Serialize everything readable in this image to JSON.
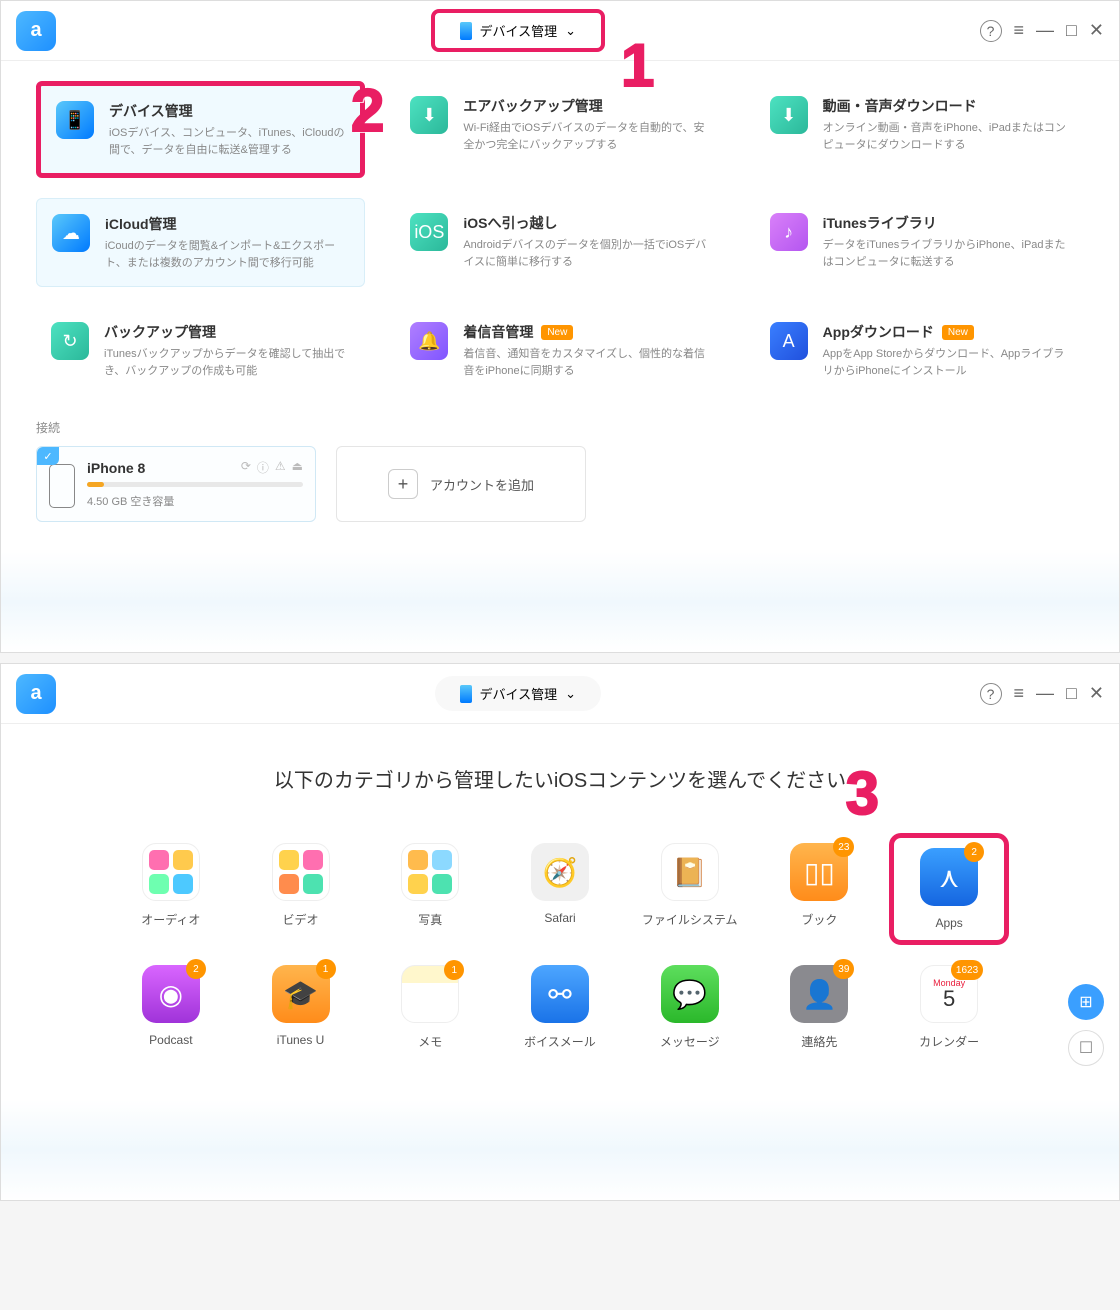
{
  "header": {
    "dropdown_label": "デバイス管理"
  },
  "callouts": {
    "n1": "1",
    "n2": "2",
    "n3": "3"
  },
  "tiles": [
    {
      "title": "デバイス管理",
      "desc": "iOSデバイス、コンピュータ、iTunes、iCloudの間で、データを自由に転送&管理する",
      "icon": "i-blue",
      "glyph": "📱",
      "highlighted": true
    },
    {
      "title": "エアバックアップ管理",
      "desc": "Wi-Fi経由でiOSデバイスのデータを自動的で、安全かつ完全にバックアップする",
      "icon": "i-teal",
      "glyph": "⬇"
    },
    {
      "title": "動画・音声ダウンロード",
      "desc": "オンライン動画・音声をiPhone、iPadまたはコンピュータにダウンロードする",
      "icon": "i-teal",
      "glyph": "⬇"
    },
    {
      "title": "iCloud管理",
      "desc": "iCoudのデータを閲覧&インポート&エクスポート、または複数のアカウント間で移行可能",
      "icon": "i-blue",
      "glyph": "☁",
      "selected": true
    },
    {
      "title": "iOSへ引っ越し",
      "desc": "Androidデバイスのデータを個別か一括でiOSデバイスに簡単に移行する",
      "icon": "i-teal",
      "glyph": "iOS"
    },
    {
      "title": "iTunesライブラリ",
      "desc": "データをiTunesライブラリからiPhone、iPadまたはコンピュータに転送する",
      "icon": "i-pink",
      "glyph": "♪"
    },
    {
      "title": "バックアップ管理",
      "desc": "iTunesバックアップからデータを確認して抽出でき、バックアップの作成も可能",
      "icon": "i-teal",
      "glyph": "↻"
    },
    {
      "title": "着信音管理",
      "desc": "着信音、通知音をカスタマイズし、個性的な着信音をiPhoneに同期する",
      "icon": "i-purple",
      "glyph": "🔔",
      "badge": "New"
    },
    {
      "title": "Appダウンロード",
      "desc": "AppをApp Storeからダウンロード、AppライブラリからiPhoneにインストール",
      "icon": "i-darkblue",
      "glyph": "A",
      "badge": "New"
    }
  ],
  "connect": {
    "label": "接続",
    "device_name": "iPhone 8",
    "storage": "4.50 GB 空き容量",
    "add_account": "アカウントを追加"
  },
  "screen2": {
    "heading": "以下のカテゴリから管理したいiOSコンテンツを選んでください",
    "categories": [
      {
        "label": "オーディオ",
        "type": "multi",
        "colors": [
          "#ff6fb0",
          "#ffca4d",
          "#6effb0",
          "#4dc9ff"
        ]
      },
      {
        "label": "ビデオ",
        "type": "multi",
        "colors": [
          "#ffd24d",
          "#ff6fb0",
          "#ff8c4d",
          "#4de2b0"
        ]
      },
      {
        "label": "写真",
        "type": "multi",
        "colors": [
          "#ffbb4d",
          "#8cd9ff",
          "#ffd24d",
          "#4de2b0"
        ]
      },
      {
        "label": "Safari",
        "type": "single",
        "cls": "ico-safari",
        "glyph": "🧭"
      },
      {
        "label": "ファイルシステム",
        "type": "single",
        "cls": "ico-files",
        "glyph": "📔"
      },
      {
        "label": "ブック",
        "type": "single",
        "cls": "ico-books",
        "glyph": "▯▯",
        "badge": "23"
      },
      {
        "label": "Apps",
        "type": "single",
        "cls": "ico-apps",
        "glyph": "⋏",
        "badge": "2",
        "highlighted": true
      },
      {
        "label": "Podcast",
        "type": "single",
        "cls": "ico-podcast",
        "glyph": "◉",
        "badge": "2"
      },
      {
        "label": "iTunes U",
        "type": "single",
        "cls": "ico-itunesu",
        "glyph": "🎓",
        "badge": "1"
      },
      {
        "label": "メモ",
        "type": "single",
        "cls": "ico-memo",
        "glyph": "",
        "badge": "1"
      },
      {
        "label": "ボイスメール",
        "type": "single",
        "cls": "ico-voicemail",
        "glyph": "⚯"
      },
      {
        "label": "メッセージ",
        "type": "single",
        "cls": "ico-message",
        "glyph": "💬"
      },
      {
        "label": "連絡先",
        "type": "single",
        "cls": "ico-contacts",
        "glyph": "👤",
        "badge": "39"
      },
      {
        "label": "カレンダー",
        "type": "calendar",
        "month": "Monday",
        "day": "5",
        "badge": "1623"
      }
    ]
  }
}
